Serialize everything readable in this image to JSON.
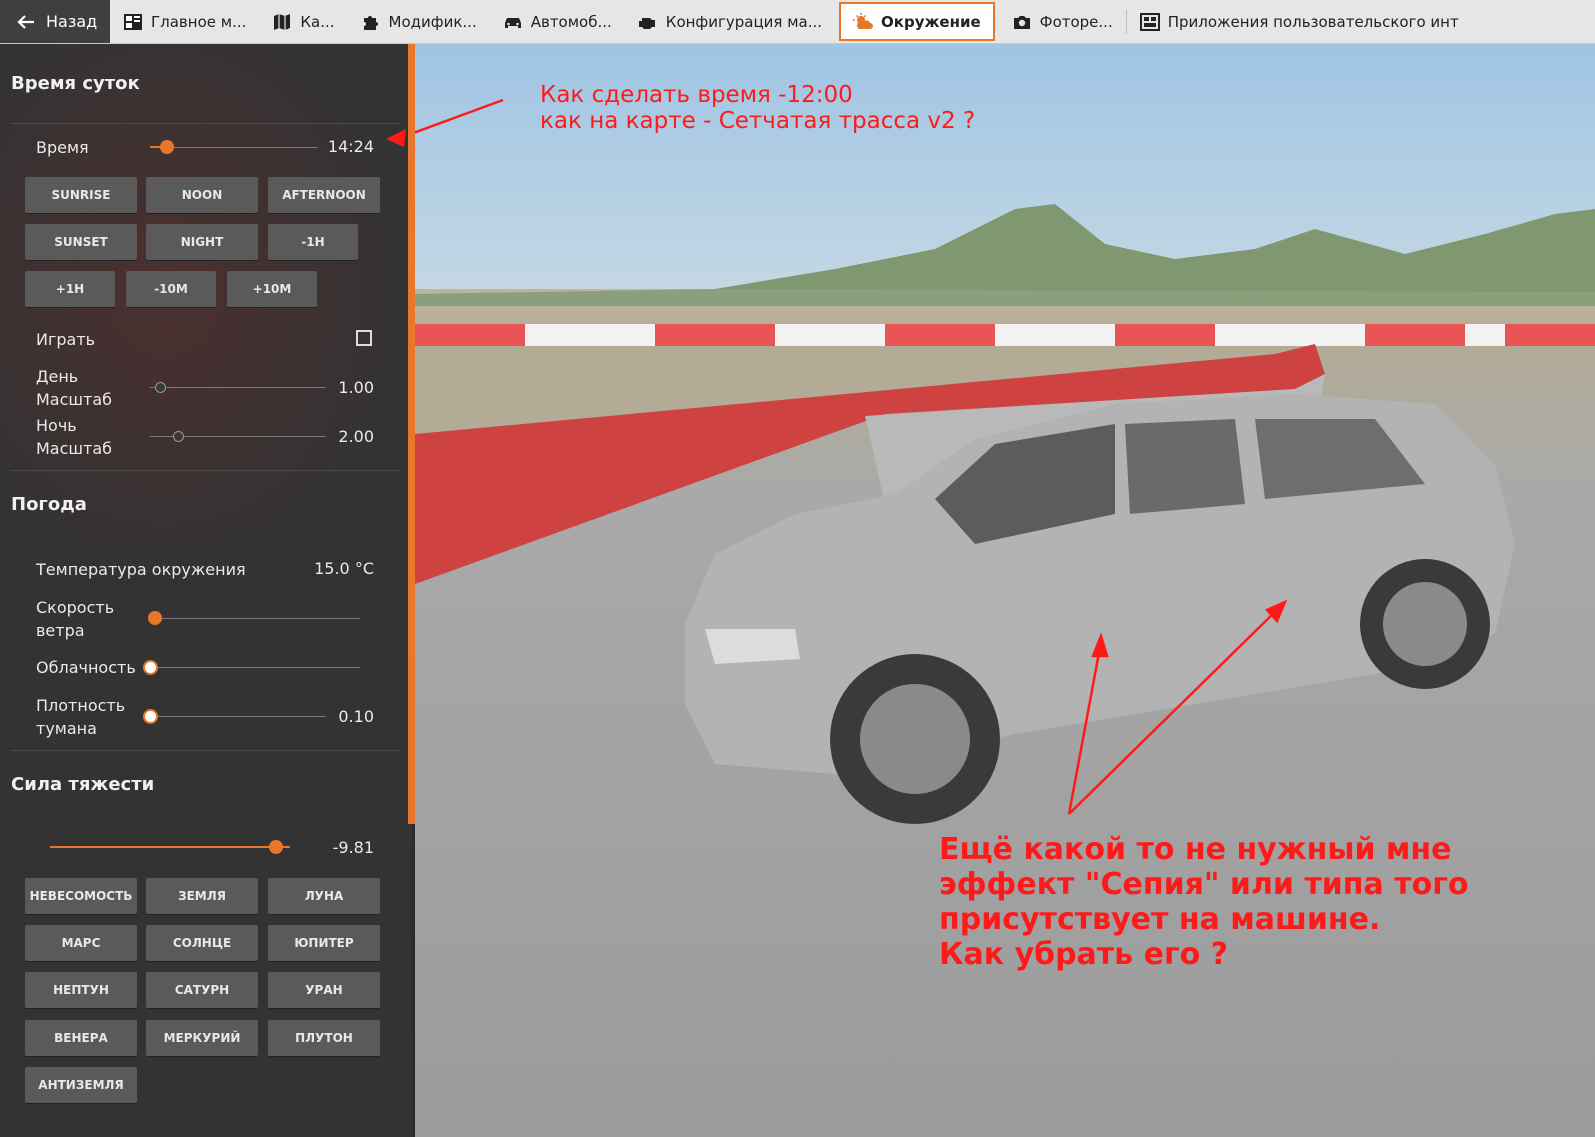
{
  "topbar": {
    "back_label": "Назад",
    "tabs": [
      {
        "label": "Главное м...",
        "icon": "dashboard-icon"
      },
      {
        "label": "Ка...",
        "icon": "map-icon"
      },
      {
        "label": "Модифик...",
        "icon": "puzzle-icon"
      },
      {
        "label": "Автомоб...",
        "icon": "car-icon"
      },
      {
        "label": "Конфигурация ма...",
        "icon": "engine-icon"
      },
      {
        "label": "Окружение",
        "icon": "weather-icon",
        "active": true
      },
      {
        "label": "Фоторе...",
        "icon": "camera-icon"
      },
      {
        "label": "Приложения пользовательского инт",
        "icon": "apps-icon"
      }
    ]
  },
  "time_section": {
    "title": "Время суток",
    "time_label": "Время",
    "time_value": "14:24",
    "buttons_row1": [
      "SUNRISE",
      "NOON",
      "AFTERNOON"
    ],
    "buttons_row2": [
      "SUNSET",
      "NIGHT",
      "-1H"
    ],
    "buttons_row3": [
      "+1H",
      "-10M",
      "+10M"
    ],
    "play_label": "Играть",
    "day_scale_label_1": "День",
    "day_scale_label_2": "Масштаб",
    "day_scale_value": "1.00",
    "night_scale_label_1": "Ночь",
    "night_scale_label_2": "Масштаб",
    "night_scale_value": "2.00"
  },
  "weather_section": {
    "title": "Погода",
    "temp_label": "Температура окружения",
    "temp_value": "15.0 °C",
    "wind_label_1": "Скорость",
    "wind_label_2": "ветра",
    "cloud_label": "Облачность",
    "fog_label_1": "Плотность",
    "fog_label_2": "тумана",
    "fog_value": "0.10"
  },
  "gravity_section": {
    "title": "Сила тяжести",
    "value": "-9.81",
    "buttons": [
      "НЕВЕСОМОСТЬ",
      "ЗЕМЛЯ",
      "ЛУНА",
      "МАРС",
      "СОЛНЦЕ",
      "ЮПИТЕР",
      "НЕПТУН",
      "САТУРН",
      "УРАН",
      "ВЕНЕРА",
      "МЕРКУРИЙ",
      "ПЛУТОН",
      "АНТИЗЕМЛЯ"
    ]
  },
  "annotations": {
    "top_line1": "Как сделать время   -12:00",
    "top_line2": "как на карте - Сетчатая трасса v2    ?",
    "bottom_line1": "Ещё какой то не нужный мне",
    "bottom_line2": "эффект \"Сепия\" или типа того",
    "bottom_line3": "присутствует на машине.",
    "bottom_line4": "Как убрать его ?"
  },
  "colors": {
    "accent": "#e8772e",
    "annotation": "#ff1a1a",
    "panel": "#333333"
  }
}
